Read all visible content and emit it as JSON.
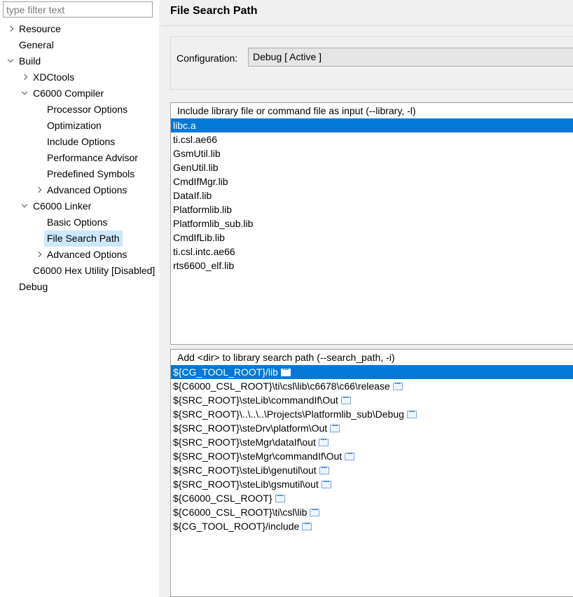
{
  "filter": {
    "placeholder": "type filter text",
    "value": ""
  },
  "tree": [
    {
      "label": "Resource",
      "twisty": "collapsed",
      "level": 0,
      "name": "tree-item-resource"
    },
    {
      "label": "General",
      "twisty": "none",
      "level": 0,
      "name": "tree-item-general"
    },
    {
      "label": "Build",
      "twisty": "expanded",
      "level": 0,
      "name": "tree-item-build"
    },
    {
      "label": "XDCtools",
      "twisty": "collapsed",
      "level": 1,
      "name": "tree-item-xdctools"
    },
    {
      "label": "C6000 Compiler",
      "twisty": "expanded",
      "level": 1,
      "name": "tree-item-c6000-compiler"
    },
    {
      "label": "Processor Options",
      "twisty": "none",
      "level": 2,
      "name": "tree-item-processor-options"
    },
    {
      "label": "Optimization",
      "twisty": "none",
      "level": 2,
      "name": "tree-item-optimization"
    },
    {
      "label": "Include Options",
      "twisty": "none",
      "level": 2,
      "name": "tree-item-include-options"
    },
    {
      "label": "Performance Advisor",
      "twisty": "none",
      "level": 2,
      "name": "tree-item-performance-advisor"
    },
    {
      "label": "Predefined Symbols",
      "twisty": "none",
      "level": 2,
      "name": "tree-item-predefined-symbols"
    },
    {
      "label": "Advanced Options",
      "twisty": "collapsed",
      "level": 2,
      "name": "tree-item-compiler-advanced-options"
    },
    {
      "label": "C6000 Linker",
      "twisty": "expanded",
      "level": 1,
      "name": "tree-item-c6000-linker"
    },
    {
      "label": "Basic Options",
      "twisty": "none",
      "level": 2,
      "name": "tree-item-basic-options"
    },
    {
      "label": "File Search Path",
      "twisty": "none",
      "level": 2,
      "name": "tree-item-file-search-path",
      "selected": true
    },
    {
      "label": "Advanced Options",
      "twisty": "collapsed",
      "level": 2,
      "name": "tree-item-linker-advanced-options"
    },
    {
      "label": "C6000 Hex Utility  [Disabled]",
      "twisty": "none",
      "level": 1,
      "name": "tree-item-c6000-hex-utility"
    },
    {
      "label": "Debug",
      "twisty": "none",
      "level": 0,
      "name": "tree-item-debug"
    }
  ],
  "page": {
    "title": "File Search Path",
    "configuration_label": "Configuration:",
    "configuration_value": "Debug  [ Active ]"
  },
  "libraries": {
    "header": "Include library file or command file as input (--library, -l)",
    "items": [
      "libc.a",
      "ti.csl.ae66",
      "GsmUtil.lib",
      "GenUtil.lib",
      "CmdIfMgr.lib",
      "DataIf.lib",
      "Platformlib.lib",
      "Platformlib_sub.lib",
      "CmdIfLib.lib",
      "ti.csl.intc.ae66",
      "rts6600_elf.lib"
    ],
    "selected_index": 0
  },
  "search_paths": {
    "header": "Add <dir> to library search path (--search_path, -i)",
    "items": [
      "${CG_TOOL_ROOT}/lib",
      "${C6000_CSL_ROOT}\\ti\\csl\\lib\\c6678\\c66\\release",
      "${SRC_ROOT}\\steLib\\commandIf\\Out",
      "${SRC_ROOT}\\..\\..\\..\\Projects\\Platformlib_sub\\Debug",
      "${SRC_ROOT}\\steDrv\\platform\\Out",
      "${SRC_ROOT}\\steMgr\\dataIf\\out",
      "${SRC_ROOT}\\steMgr\\commandIf\\Out",
      "${SRC_ROOT}\\steLib\\genutil\\out",
      "${SRC_ROOT}\\steLib\\gsmutil\\out",
      "${C6000_CSL_ROOT}",
      "${C6000_CSL_ROOT}\\ti\\csl\\lib",
      "${CG_TOOL_ROOT}/include"
    ],
    "selected_index": 0,
    "item_icon": "more-icon"
  },
  "colors": {
    "selection": "#0078d7",
    "tree_selection": "#cce8ff",
    "panel_background": "#f0f0f0"
  }
}
